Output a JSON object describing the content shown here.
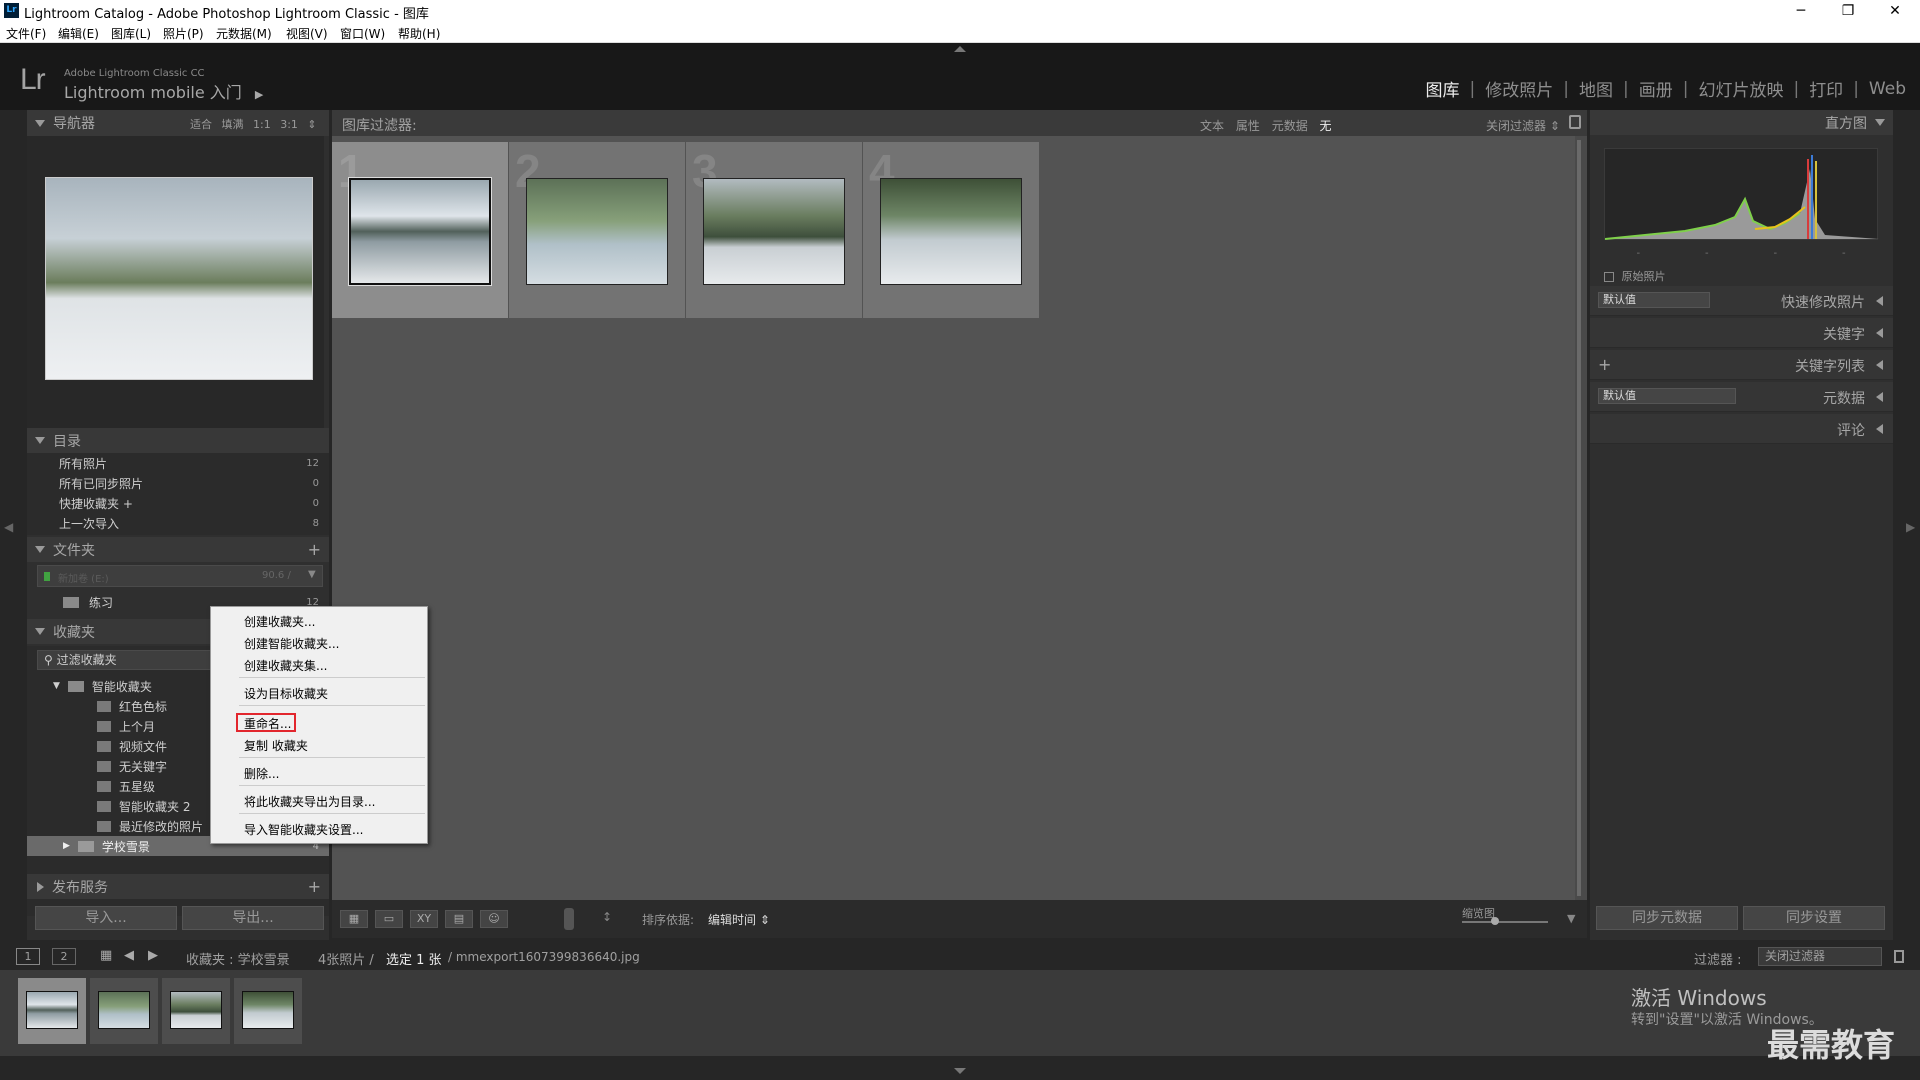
{
  "window": {
    "title": "Lightroom Catalog - Adobe Photoshop Lightroom Classic - 图库",
    "app_icon": "Lr",
    "controls": [
      "─",
      "❐",
      "✕"
    ]
  },
  "menu": [
    "文件(F)",
    "编辑(E)",
    "图库(L)",
    "照片(P)",
    "元数据(M)",
    "视图(V)",
    "窗口(W)",
    "帮助(H)"
  ],
  "identity": {
    "logo": "Lr",
    "product": "Adobe Lightroom Classic CC",
    "mobile": "Lightroom mobile 入门",
    "play": "▶"
  },
  "modules": [
    "图库",
    "修改照片",
    "地图",
    "画册",
    "幻灯片放映",
    "打印",
    "Web"
  ],
  "active_module": "图库",
  "navigator": {
    "title": "导航器",
    "options": "适合 填满 1:1 3:1 ⇕"
  },
  "catalog": {
    "title": "目录",
    "items": [
      {
        "label": "所有照片",
        "count": "12"
      },
      {
        "label": "所有已同步照片",
        "count": "0"
      },
      {
        "label": "快捷收藏夹 +",
        "count": "0"
      },
      {
        "label": "上一次导入",
        "count": "8"
      }
    ]
  },
  "folders": {
    "title": "文件夹",
    "add": "+",
    "volume": "新加卷 (E:)",
    "volume_size": "90.6 /",
    "items": [
      {
        "label": "练习",
        "count": "12"
      }
    ]
  },
  "collections": {
    "title": "收藏夹",
    "filter": "过滤收藏夹",
    "smart_group": "智能收藏夹",
    "smart_items": [
      "红色色标",
      "上个月",
      "视频文件",
      "无关键字",
      "五星级",
      "智能收藏夹 2",
      "最近修改的照片"
    ],
    "selected": {
      "label": "学校雪景",
      "count": "4"
    }
  },
  "publish": {
    "title": "发布服务",
    "add": "+"
  },
  "left_buttons": {
    "import": "导入...",
    "export": "导出..."
  },
  "filter_bar": {
    "label": "图库过滤器:",
    "options": [
      "文本",
      "属性",
      "元数据",
      "无"
    ],
    "active": "无",
    "close": "关闭过滤器 ⇕"
  },
  "grid": {
    "cells": [
      {
        "num": "1",
        "selected": true
      },
      {
        "num": "2",
        "selected": false
      },
      {
        "num": "3",
        "selected": false
      },
      {
        "num": "4",
        "selected": false
      }
    ]
  },
  "toolbar": {
    "sort_label": "排序依据:",
    "sort_value": "编辑时间 ⇕",
    "thumb_label": "缩览图",
    "view_icons": [
      "▦",
      "▭",
      "XY",
      "▤",
      "☺"
    ]
  },
  "histogram": {
    "title": "直方图",
    "original": "原始照片",
    "ticks": [
      "-",
      "-",
      "-",
      "-"
    ]
  },
  "right_sections": [
    {
      "title": "快速修改照片",
      "select": "默认值"
    },
    {
      "title": "关键字",
      "select": ""
    },
    {
      "title": "关键字列表",
      "select": "",
      "plus": "+"
    },
    {
      "title": "元数据",
      "select": "默认值"
    },
    {
      "title": "评论",
      "select": ""
    }
  ],
  "right_buttons": {
    "sync_meta": "同步元数据",
    "sync_settings": "同步设置"
  },
  "filmstrip_bar": {
    "pages": [
      "1",
      "2"
    ],
    "source": "收藏夹 : 学校雪景",
    "count": "4张照片 /",
    "selected": "选定 1 张",
    "filename": "/ mmexport1607399836640.jpg",
    "filter_label": "过滤器 :",
    "filter_value": "关闭过滤器"
  },
  "context_menu": {
    "items": [
      "创建收藏夹...",
      "创建智能收藏夹...",
      "创建收藏夹集...",
      "设为目标收藏夹",
      "重命名...",
      "复制 收藏夹",
      "删除...",
      "将此收藏夹导出为目录...",
      "导入智能收藏夹设置..."
    ],
    "highlighted": "重命名..."
  },
  "watermark": {
    "line1": "激活 Windows",
    "line2": "转到\"设置\"以激活 Windows。"
  },
  "brand": "最需教育"
}
